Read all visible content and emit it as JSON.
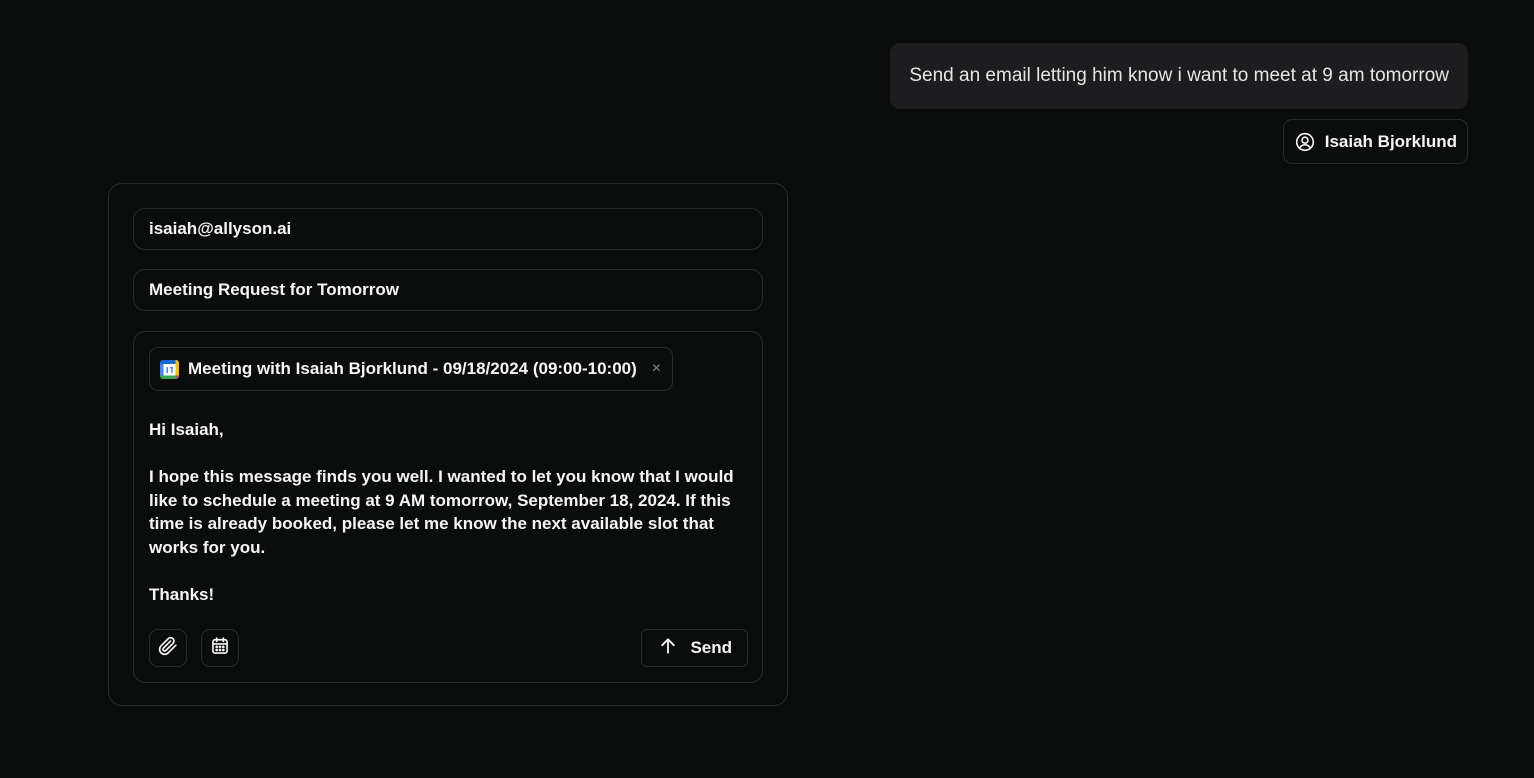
{
  "chat": {
    "user_message": "Send an email letting him know i want to meet at 9 am tomorrow",
    "contact_chip": {
      "icon": "user-circle-icon",
      "name": "Isaiah Bjorklund"
    }
  },
  "composer": {
    "to": "isaiah@allyson.ai",
    "subject": "Meeting Request for Tomorrow",
    "attachment": {
      "icon": "google-calendar-icon",
      "label": "Meeting with Isaiah Bjorklund - 09/18/2024 (09:00-10:00)",
      "remove_glyph": "×"
    },
    "body": {
      "greeting": "Hi Isaiah,",
      "paragraph": "I hope this message finds you well. I wanted to let you know that I would like to schedule a meeting at 9 AM tomorrow, September 18, 2024. If this time is already booked, please let me know the next available slot that works for you.",
      "signoff": "Thanks!"
    },
    "toolbar": {
      "attach_icon": "paperclip-icon",
      "calendar_icon": "calendar-icon",
      "send_icon": "arrow-up-icon",
      "send_label": "Send"
    }
  },
  "colors": {
    "background": "#0b0c0c",
    "bubble": "#1d1d1f",
    "border": "#2a2b2d",
    "text": "#f5f5f5",
    "muted": "#8b8b8b"
  }
}
